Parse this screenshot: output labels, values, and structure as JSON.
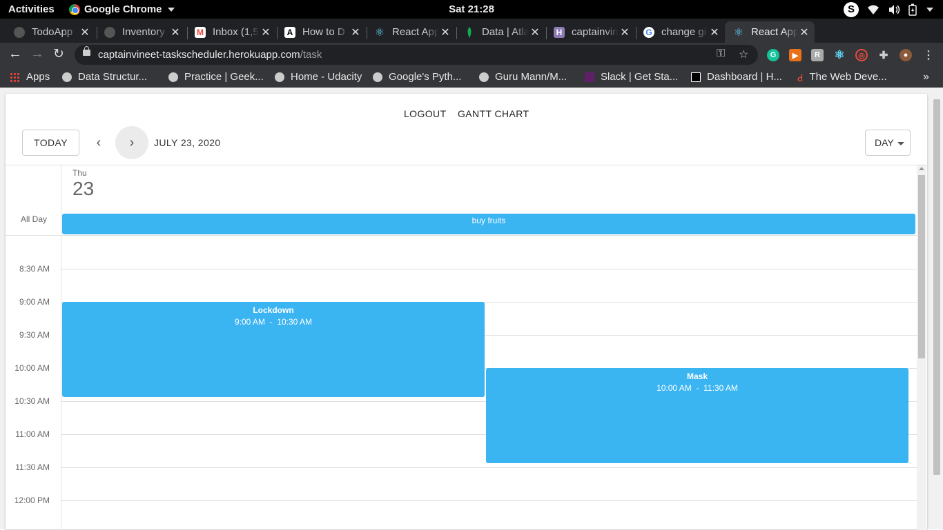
{
  "system": {
    "activities": "Activities",
    "app_name": "Google Chrome",
    "clock": "Sat 21:28",
    "tray_icons": [
      "skype-icon",
      "wifi-icon",
      "volume-icon",
      "battery-icon",
      "power-menu-icon"
    ]
  },
  "tabs": [
    {
      "title": "TodoApp",
      "icon": "github-icon"
    },
    {
      "title": "Inventory",
      "icon": "github-icon"
    },
    {
      "title": "Inbox (1,5",
      "icon": "gmail-icon"
    },
    {
      "title": "How to D",
      "icon": "site-icon"
    },
    {
      "title": "React App",
      "icon": "react-icon"
    },
    {
      "title": "Data | Atla",
      "icon": "mongodb-icon"
    },
    {
      "title": "captainvin",
      "icon": "heroku-icon"
    },
    {
      "title": "change gi",
      "icon": "google-icon"
    },
    {
      "title": "React App",
      "icon": "react-icon",
      "active": true
    }
  ],
  "omnibox": {
    "host": "captainvineet-taskscheduler.herokuapp.com",
    "path": "/task"
  },
  "bookmarks": [
    {
      "label": "Apps"
    },
    {
      "label": "Data Structur..."
    },
    {
      "label": "Practice | Geek..."
    },
    {
      "label": "Home - Udacity"
    },
    {
      "label": "Google's Pyth..."
    },
    {
      "label": "Guru Mann/M..."
    },
    {
      "label": "Slack | Get Sta..."
    },
    {
      "label": "Dashboard | H..."
    },
    {
      "label": "The Web Deve..."
    }
  ],
  "app": {
    "nav": {
      "logout": "LOGOUT",
      "gantt": "GANTT CHART"
    },
    "toolbar": {
      "today": "TODAY",
      "date": "JULY 23, 2020",
      "view": "DAY"
    },
    "day": {
      "name": "Thu",
      "number": "23"
    },
    "all_day_label": "All Day",
    "all_day_event": "buy fruits",
    "time_labels": [
      "8:30 AM",
      "9:00 AM",
      "9:30 AM",
      "10:00 AM",
      "10:30 AM",
      "11:00 AM",
      "11:30 AM",
      "12:00 PM"
    ],
    "events": [
      {
        "title": "Lockdown",
        "time": "9:00 AM  -  10:30 AM"
      },
      {
        "title": "Mask",
        "time": "10:00 AM  -  11:30 AM"
      }
    ],
    "event_color": "#3bb4f2"
  }
}
